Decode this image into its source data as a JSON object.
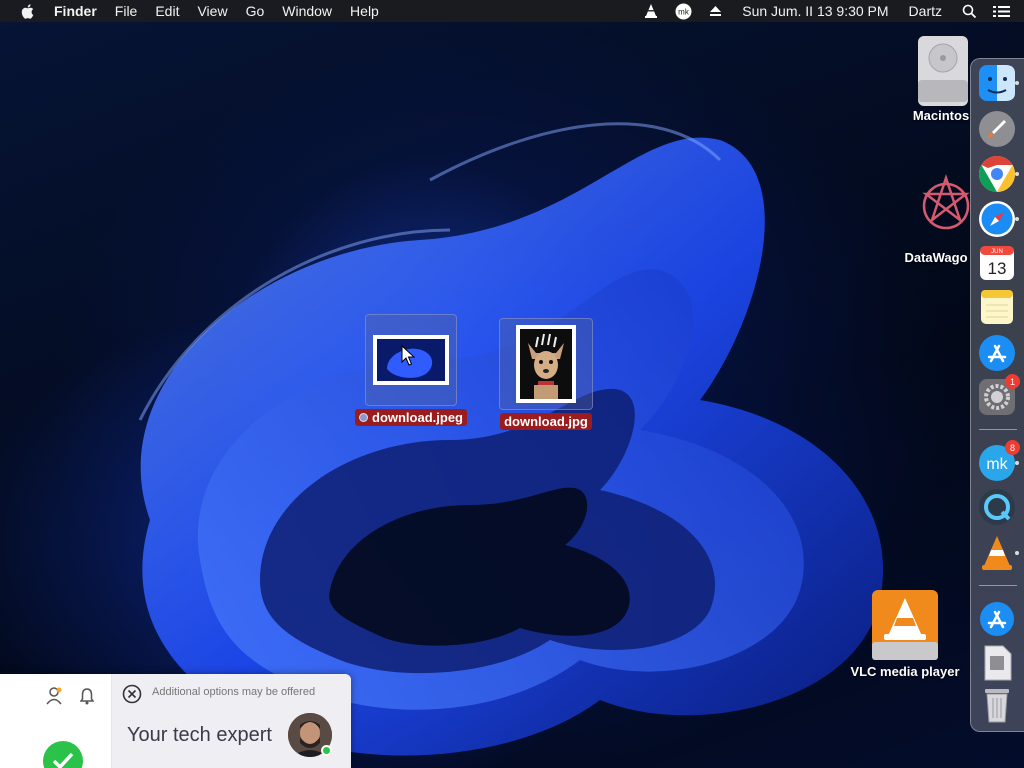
{
  "menubar": {
    "app_name": "Finder",
    "menus": [
      "File",
      "Edit",
      "View",
      "Go",
      "Window",
      "Help"
    ],
    "clock": "Sun Jum. II 13  9:30 PM",
    "user": "Dartz",
    "status_icons": [
      "vlc-icon",
      "mk-icon",
      "eject-icon",
      "search-icon",
      "control-center-icon"
    ]
  },
  "desktop": {
    "icons": [
      {
        "label": "Macintos",
        "icon": "hard-drive-icon"
      },
      {
        "label": "DataWago",
        "icon": "datawago-icon"
      },
      {
        "label": "VLC media player",
        "icon": "vlc-drive-icon"
      }
    ],
    "files": [
      {
        "label": "download.jpeg",
        "tagged": true,
        "selected": true
      },
      {
        "label": "download.jpg",
        "tagged": false,
        "selected": true
      }
    ]
  },
  "dock": {
    "items": [
      {
        "name": "finder-icon",
        "running": true
      },
      {
        "name": "launchpad-icon",
        "running": false
      },
      {
        "name": "chrome-icon",
        "running": true
      },
      {
        "name": "safari-icon",
        "running": true
      },
      {
        "name": "calendar-icon",
        "running": false,
        "text": "13",
        "month": "JUN"
      },
      {
        "name": "notes-icon",
        "running": false
      },
      {
        "name": "app-store-icon",
        "running": false
      },
      {
        "name": "system-preferences-icon",
        "running": false,
        "badge": "1"
      },
      {
        "name": "mk-app-icon",
        "running": true,
        "badge": "8"
      },
      {
        "name": "quicktime-icon",
        "running": false
      },
      {
        "name": "vlc-icon",
        "running": true
      },
      {
        "name": "app-store-downloads-icon",
        "running": false
      },
      {
        "name": "file-icon",
        "running": false
      },
      {
        "name": "trash-icon",
        "running": false
      }
    ]
  },
  "widget": {
    "notice": "Additional options may be offered",
    "title": "Your tech expert",
    "icons": [
      "person-icon",
      "bell-icon",
      "close-circle-icon",
      "checkmark-icon"
    ],
    "colors": {
      "online": "#2bc24a",
      "check": "#2bc24a"
    }
  }
}
